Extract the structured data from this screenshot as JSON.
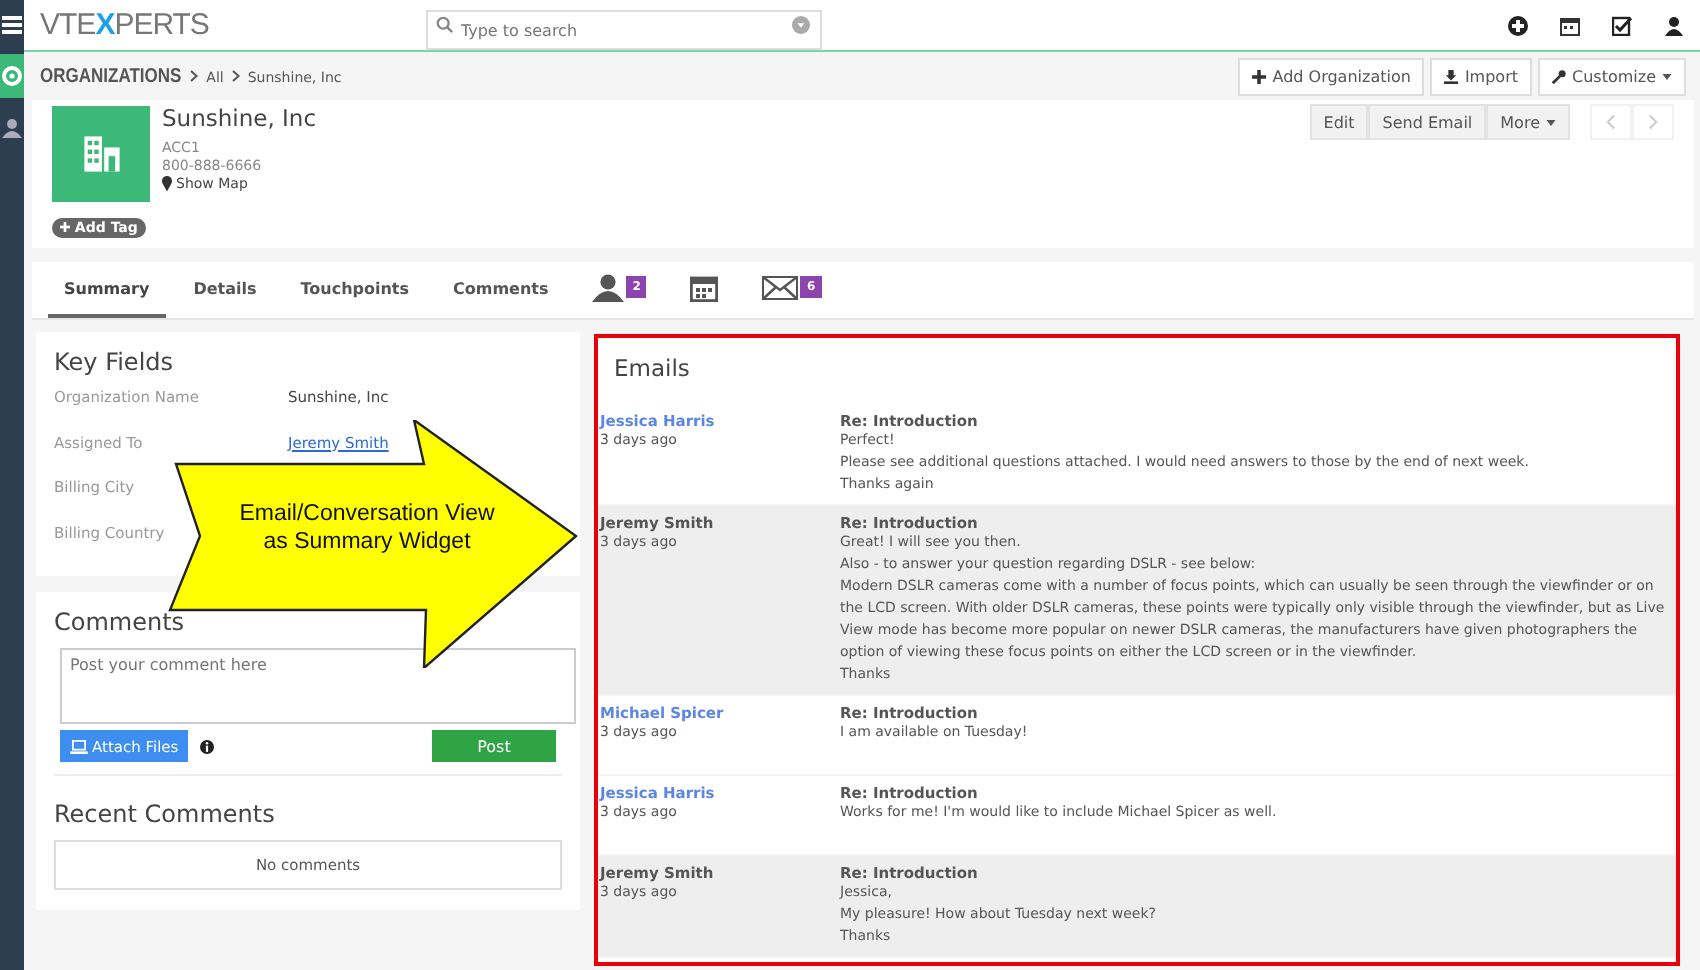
{
  "logo": {
    "before": "VTE",
    "mark": "X",
    "after": "PERTS"
  },
  "search": {
    "placeholder": "Type to search"
  },
  "breadcrumb": {
    "module": "ORGANIZATIONS",
    "path": [
      "All",
      "Sunshine, Inc"
    ]
  },
  "header_actions": [
    "Add Organization",
    "Import",
    "Customize"
  ],
  "record": {
    "name": "Sunshine, Inc",
    "code": "ACC1",
    "phone": "800-888-6666",
    "map_link": "Show Map",
    "tag_button": "Add Tag"
  },
  "record_actions": [
    "Edit",
    "Send Email",
    "More"
  ],
  "tabs": [
    {
      "kind": "text",
      "label": "Summary",
      "selected": true
    },
    {
      "kind": "text",
      "label": "Details",
      "selected": false
    },
    {
      "kind": "text",
      "label": "Touchpoints",
      "selected": false
    },
    {
      "kind": "text",
      "label": "Comments",
      "selected": false
    },
    {
      "kind": "people",
      "badge": "2",
      "selected": false
    },
    {
      "kind": "calendar",
      "selected": false
    },
    {
      "kind": "mail",
      "badge": "6",
      "selected": false
    }
  ],
  "key_fields": {
    "title": "Key Fields",
    "fields": [
      {
        "label": "Organization Name",
        "value": "Sunshine, Inc",
        "link": false
      },
      {
        "label": "Assigned To",
        "value": "Jeremy Smith",
        "link": true
      },
      {
        "label": "Billing City"
      },
      {
        "label": "Billing Country"
      }
    ]
  },
  "comments": {
    "title": "Comments",
    "placeholder": "Post your comment here",
    "attach": "Attach Files",
    "post": "Post",
    "recent_title": "Recent Comments",
    "empty": "No comments"
  },
  "callout": "Email/Conversation View as Summary Widget",
  "emails": {
    "title": "Emails",
    "items": [
      {
        "kind": "received",
        "sender": "Jessica Harris",
        "time": "3 days ago",
        "subject": "Re: Introduction",
        "lines": [
          "Perfect!",
          "Please see additional questions attached. I would need answers to those by the end of next week.",
          "Thanks again"
        ]
      },
      {
        "kind": "sent",
        "sender": "Jeremy Smith",
        "time": "3 days ago",
        "subject": "Re: Introduction",
        "lines": [
          "Great! I will see you then.",
          "Also - to answer your question regarding DSLR - see below:",
          "Modern DSLR cameras come with a number of focus points, which can usually be seen through the viewfinder or on the LCD screen. With older DSLR cameras, these points were typically only visible through the viewfinder, but as Live View mode has become more popular on newer DSLR cameras, the manufacturers have given photographers the option of viewing these focus points on either the LCD screen or in the viewfinder.",
          "Thanks"
        ]
      },
      {
        "kind": "received",
        "sender": "Michael Spicer",
        "time": "3 days ago",
        "subject": "Re: Introduction",
        "lines": [
          "I am available on Tuesday!"
        ]
      },
      {
        "kind": "received",
        "sender": "Jessica Harris",
        "time": "3 days ago",
        "subject": "Re: Introduction",
        "lines": [
          "Works for me! I'm would like to include Michael Spicer as well."
        ]
      },
      {
        "kind": "sent",
        "sender": "Jeremy Smith",
        "time": "3 days ago",
        "subject": "Re: Introduction",
        "lines": [
          "Jessica,",
          "My pleasure! How about Tuesday next week?",
          "Thanks"
        ]
      }
    ]
  }
}
